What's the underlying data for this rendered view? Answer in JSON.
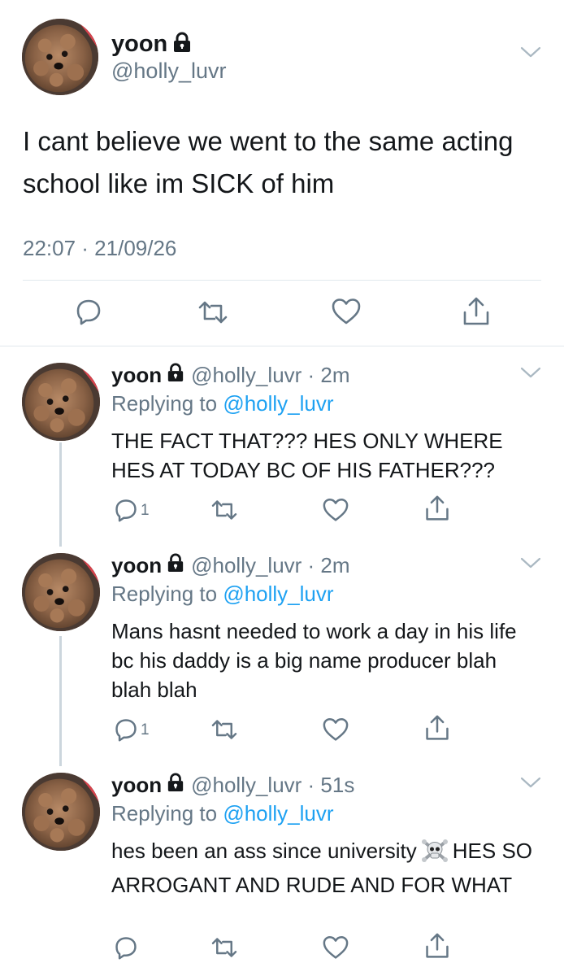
{
  "main_tweet": {
    "display_name": "yoon",
    "handle": "@holly_luvr",
    "text": "I cant believe we went to the same acting school like im SICK of him",
    "timestamp": "22:07 · 21/09/26",
    "icons": [
      "lock-icon",
      "chevron-down-icon",
      "reply-icon",
      "retweet-icon",
      "like-icon",
      "share-icon"
    ]
  },
  "replies": [
    {
      "display_name": "yoon",
      "handle_time": "@holly_luvr · 2m",
      "replying_prefix": "Replying to",
      "replying_to": "@holly_luvr",
      "text": "THE FACT THAT??? HES ONLY WHERE HES AT TODAY BC OF HIS FATHER???",
      "reply_count": "1"
    },
    {
      "display_name": "yoon",
      "handle_time": "@holly_luvr · 2m",
      "replying_prefix": "Replying to",
      "replying_to": "@holly_luvr",
      "text": "Mans hasnt needed to work a day in his life bc his daddy is a big name producer blah blah blah",
      "reply_count": "1"
    },
    {
      "display_name": "yoon",
      "handle_time": "@holly_luvr · 51s",
      "replying_prefix": "Replying to",
      "replying_to": "@holly_luvr",
      "text_before_emoji": "hes been an ass since university",
      "emoji": "skull-crossbones-emoji",
      "text_after_emoji": "HES SO ARROGANT AND RUDE AND FOR WHAT",
      "reply_count": ""
    }
  ],
  "colors": {
    "text": "#14171a",
    "secondary": "#657786",
    "link": "#1da1f2",
    "divider": "#e1e8ed",
    "thread_line": "#ccd6dd"
  }
}
